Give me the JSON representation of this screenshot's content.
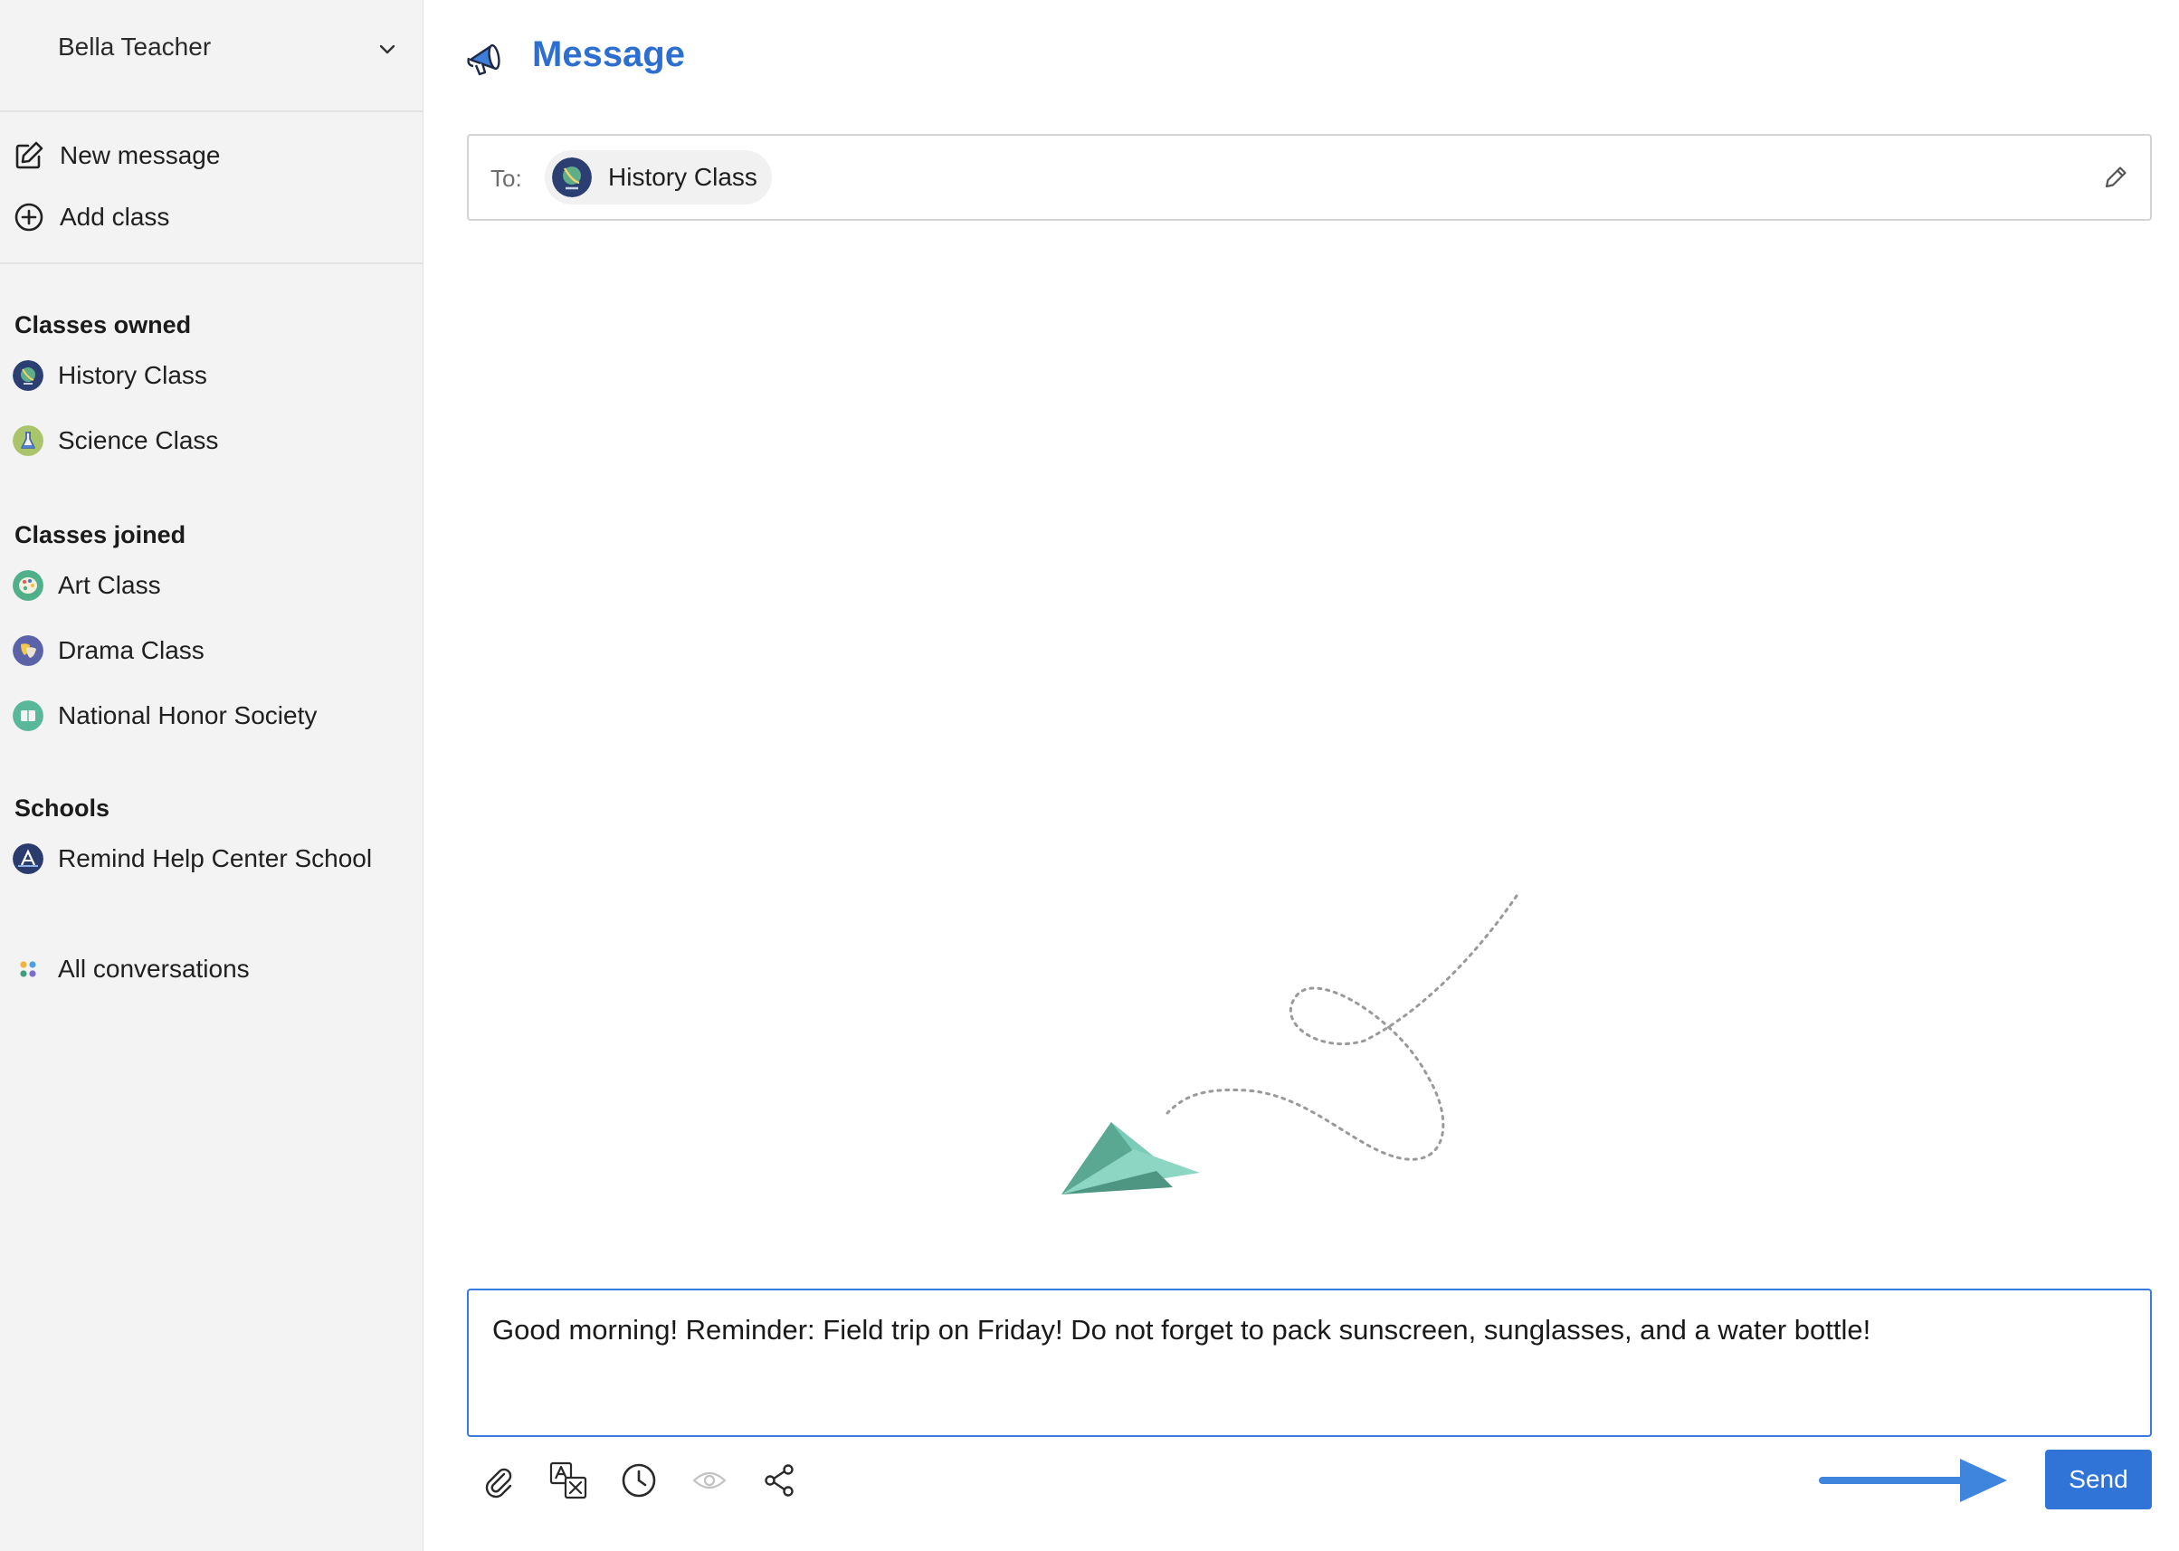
{
  "sidebar": {
    "account_name": "Bella Teacher",
    "actions": [
      {
        "label": "New message",
        "icon": "compose-icon"
      },
      {
        "label": "Add class",
        "icon": "plus-circle-icon"
      }
    ],
    "classes_owned": {
      "title": "Classes owned",
      "items": [
        {
          "label": "History Class",
          "icon": "globe-avatar"
        },
        {
          "label": "Science Class",
          "icon": "flask-avatar"
        }
      ]
    },
    "classes_joined": {
      "title": "Classes joined",
      "items": [
        {
          "label": "Art Class",
          "icon": "palette-avatar"
        },
        {
          "label": "Drama Class",
          "icon": "theater-masks-avatar"
        },
        {
          "label": "National Honor Society",
          "icon": "book-avatar"
        }
      ]
    },
    "schools": {
      "title": "Schools",
      "items": [
        {
          "label": "Remind Help Center School",
          "icon": "school-avatar"
        }
      ]
    },
    "all_conversations": "All conversations"
  },
  "main": {
    "title": "Message",
    "to_label": "To:",
    "recipient": "History Class",
    "message_text": "Good morning! Reminder: Field trip on Friday! Do not forget to pack sunscreen, sunglasses, and a water bottle!",
    "toolbar": [
      "paperclip-icon",
      "translate-icon",
      "clock-icon",
      "eye-icon",
      "share-icon"
    ],
    "send_label": "Send"
  },
  "colors": {
    "accent": "#2f74d6",
    "title_blue": "#2d6fd1",
    "sidebar_bg": "#f3f3f4",
    "plane_teal": "#6cbfae"
  }
}
